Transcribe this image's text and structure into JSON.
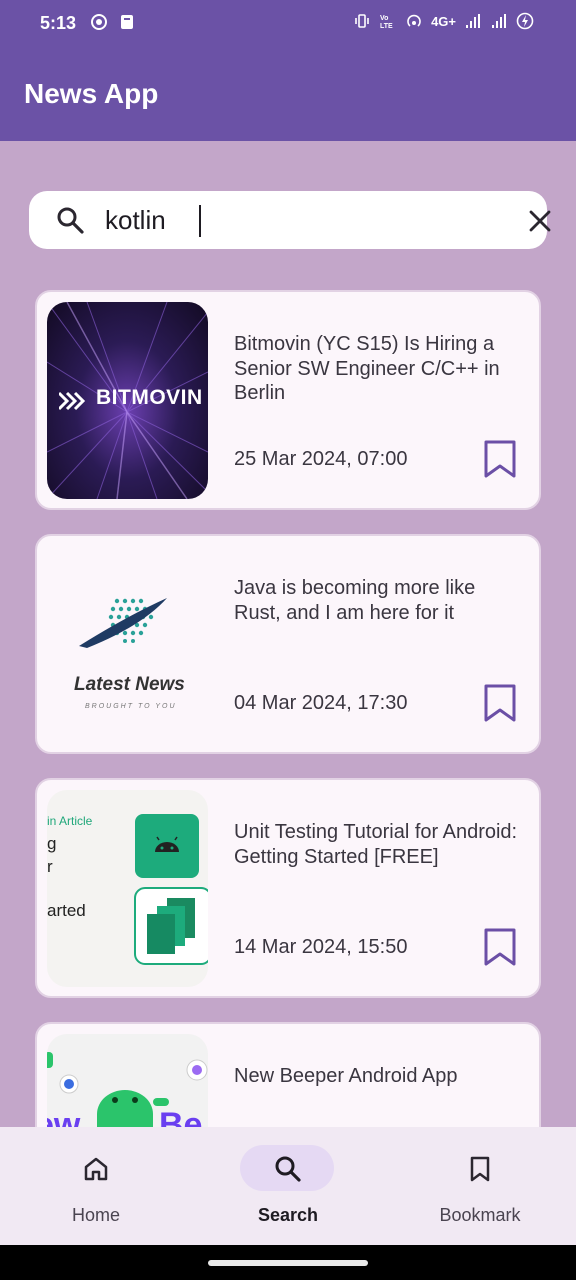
{
  "status_bar": {
    "time": "5:13",
    "network": "4G+"
  },
  "app_bar": {
    "title": "News App"
  },
  "search": {
    "value": "kotlin",
    "placeholder": ""
  },
  "articles": [
    {
      "title": "Bitmovin (YC S15) Is Hiring a Senior SW Engineer C/C++ in Berlin",
      "date": "25 Mar 2024, 07:00",
      "thumb_logo": "BITMOVIN"
    },
    {
      "title": "Java is becoming more like Rust, and I am here for it",
      "date": "04 Mar 2024, 17:30",
      "thumb_logo": "Latest News",
      "thumb_sub": "BROUGHT TO YOU"
    },
    {
      "title": "Unit Testing Tutorial for Android: Getting Started [FREE]",
      "date": "14 Mar 2024, 15:50",
      "thumb_label": "in Article",
      "thumb_line1": "g",
      "thumb_line2": "r",
      "thumb_line3": "arted"
    },
    {
      "title": "New Beeper Android App",
      "date": ""
    }
  ],
  "bottom_nav": {
    "items": [
      {
        "label": "Home",
        "icon": "home-icon",
        "active": false
      },
      {
        "label": "Search",
        "icon": "search-icon",
        "active": true
      },
      {
        "label": "Bookmark",
        "icon": "bookmark-icon",
        "active": false
      }
    ]
  },
  "colors": {
    "primary": "#6b52a6",
    "background": "#c3a6c9",
    "card": "#fcf6fb",
    "nav_background": "#f1e9f3",
    "nav_active_pill": "#e5d9f3",
    "bookmark": "#6b4fa6"
  }
}
